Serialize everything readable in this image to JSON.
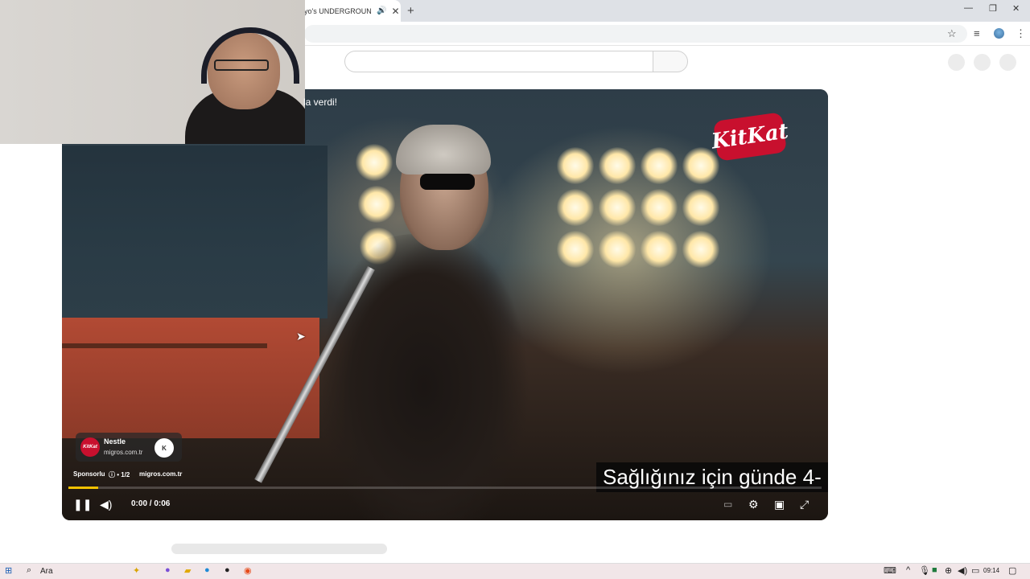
{
  "browser": {
    "tab_title": "yo's UNDERGROUND S",
    "tab_audio_icon": "speaker-icon",
    "new_tab": "+",
    "win_min": "—",
    "win_max": "❐",
    "win_close": "✕"
  },
  "video": {
    "overlay_text": "la verdi!",
    "brand_logo": "KitKat",
    "ad": {
      "advertiser": "Nestle",
      "domain": "migros.com.tr",
      "avatar_text": "KitKat",
      "info_button": "K",
      "sponsored_label": "Sponsorlu",
      "counter": "ⓘ • 1/2",
      "link": "migros.com.tr",
      "progress": 0.04
    },
    "caption": "Sağlığınız için günde 4-",
    "time": "0:00 / 0:06",
    "accent": "#f2c200"
  },
  "taskbar": {
    "search_label": "Ara",
    "clock": "09:14"
  }
}
